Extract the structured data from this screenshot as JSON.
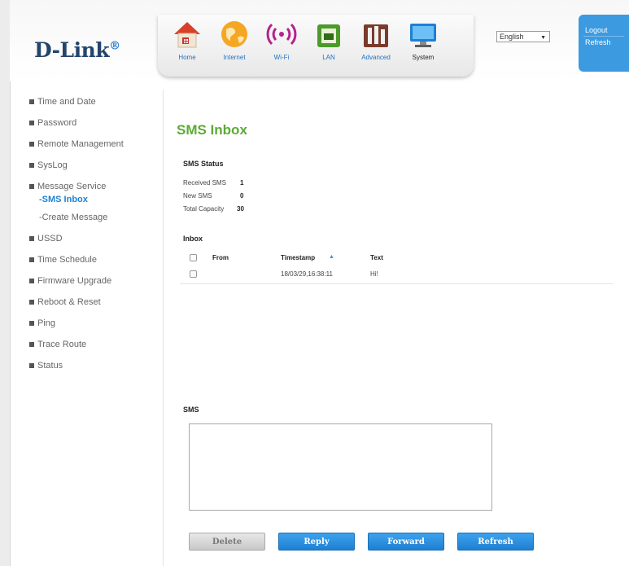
{
  "header": {
    "logo_text": "D-Link",
    "logo_mark": "®",
    "nav": [
      {
        "label": "Home",
        "icon": "home-icon"
      },
      {
        "label": "Internet",
        "icon": "globe-icon"
      },
      {
        "label": "Wi-Fi",
        "icon": "wifi-icon"
      },
      {
        "label": "LAN",
        "icon": "lan-icon"
      },
      {
        "label": "Advanced",
        "icon": "tools-icon"
      },
      {
        "label": "System",
        "icon": "monitor-icon"
      }
    ],
    "active_nav": "System",
    "language": "English",
    "logout_label": "Logout",
    "refresh_label": "Refresh"
  },
  "sidebar": {
    "items": [
      {
        "label": "Time and Date"
      },
      {
        "label": "Password"
      },
      {
        "label": "Remote Management"
      },
      {
        "label": "SysLog"
      },
      {
        "label": "Message Service"
      },
      {
        "label": "-SMS Inbox"
      },
      {
        "label": "-Create Message"
      },
      {
        "label": "USSD"
      },
      {
        "label": "Time Schedule"
      },
      {
        "label": "Firmware Upgrade"
      },
      {
        "label": "Reboot & Reset"
      },
      {
        "label": "Ping"
      },
      {
        "label": "Trace Route"
      },
      {
        "label": "Status"
      }
    ]
  },
  "main": {
    "title": "SMS Inbox",
    "status_heading": "SMS Status",
    "status": {
      "received_label": "Received SMS",
      "received_value": "1",
      "new_label": "New SMS",
      "new_value": "0",
      "capacity_label": "Total Capacity",
      "capacity_value": "30"
    },
    "inbox_heading": "Inbox",
    "columns": {
      "from": "From",
      "timestamp": "Timestamp",
      "text": "Text"
    },
    "rows": [
      {
        "from": "",
        "timestamp": "18/03/29,16:38:11",
        "text": "Hi!"
      }
    ],
    "sms_heading": "SMS",
    "sms_value": "",
    "buttons": {
      "delete": "Delete",
      "reply": "Reply",
      "forward": "Forward",
      "refresh": "Refresh"
    }
  },
  "colors": {
    "title_green": "#5bab35",
    "accent_blue": "#1f82d8",
    "logo_navy": "#24456b"
  }
}
